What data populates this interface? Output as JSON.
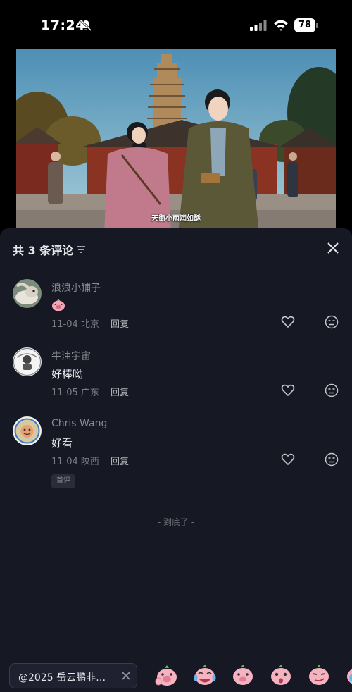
{
  "status_bar": {
    "time": "17:24",
    "battery": "78"
  },
  "video": {
    "subtitle": "天街小雨润如酥"
  },
  "comments_panel": {
    "title": "共 3 条评论",
    "comments": [
      {
        "user": "浪浪小铺子",
        "text": "",
        "emoji": "pig-face",
        "date": "11-04",
        "location": "北京",
        "reply": "回复"
      },
      {
        "user": "牛油宇宙",
        "text": "好棒呦",
        "date": "11-05",
        "location": "广东",
        "reply": "回复"
      },
      {
        "user": "Chris Wang",
        "text": "好看",
        "date": "11-04",
        "location": "陕西",
        "reply": "回复",
        "tag": "首评"
      }
    ],
    "end_text": "- 到底了 -"
  },
  "input_bar": {
    "value": "@2025 岳云鹏非…"
  },
  "emoji_bar": {
    "items": [
      "pig-wave",
      "pig-crying-laugh",
      "pig-smile",
      "pig-surprised",
      "pig-smirk",
      "pig-partial"
    ]
  }
}
